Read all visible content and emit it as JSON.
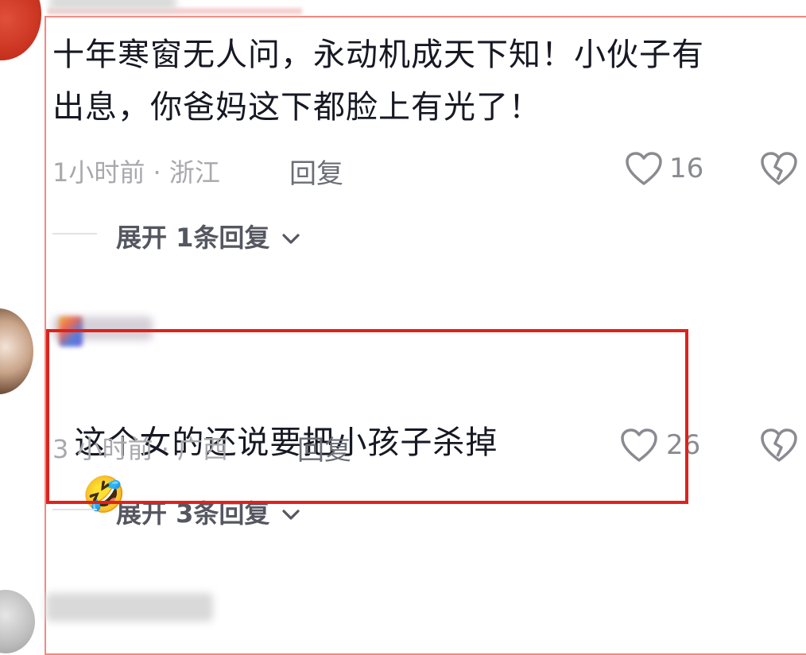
{
  "comments": [
    {
      "text": "十年寒窗无人问，永动机成天下知！小伙子有\n出息，你爸妈这下都脸上有光了！",
      "time_location": "1小时前 · 浙江",
      "reply_label": "回复",
      "likes": "16",
      "expand_label": "展开 1条回复"
    },
    {
      "text": "这个女的还说要把小孩子杀掉",
      "emoji": "🤣",
      "time_location": "3 小时前 · 广西",
      "reply_label": "回复",
      "likes": "26",
      "expand_label": "展开 3条回复"
    }
  ],
  "colors": {
    "annotation_red": "#e0211b",
    "text_primary": "#161823",
    "text_meta": "#a8a8ad"
  },
  "icons": [
    "heart-outline-icon",
    "broken-heart-icon",
    "chevron-down-icon",
    "rolling-laugh-emoji"
  ]
}
